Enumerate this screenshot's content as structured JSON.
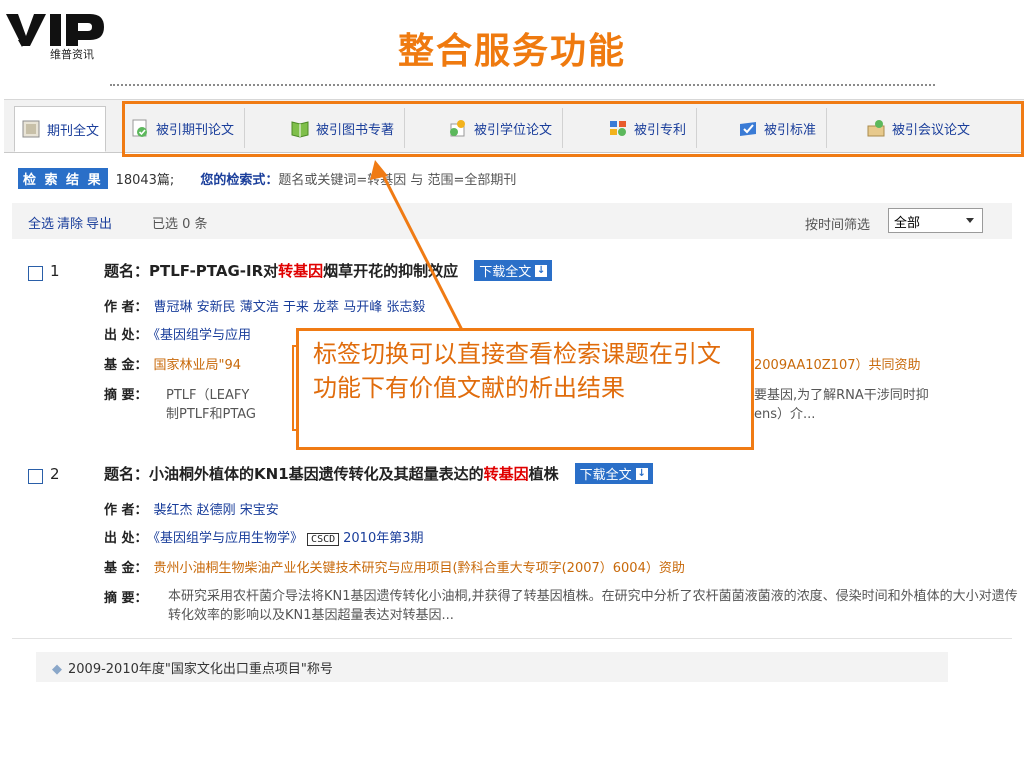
{
  "logo": {
    "brand": "VIP",
    "subtitle": "维普资讯"
  },
  "slide_title": "整合服务功能",
  "tabs": [
    {
      "label": "期刊全文",
      "icon": "journal-icon",
      "active": true
    },
    {
      "label": "被引期刊论文",
      "icon": "cited-paper-icon",
      "active": false
    },
    {
      "label": "被引图书专著",
      "icon": "book-icon",
      "active": false
    },
    {
      "label": "被引学位论文",
      "icon": "degree-thesis-icon",
      "active": false
    },
    {
      "label": "被引专利",
      "icon": "patent-icon",
      "active": false
    },
    {
      "label": "被引标准",
      "icon": "standard-icon",
      "active": false
    },
    {
      "label": "被引会议论文",
      "icon": "conference-icon",
      "active": false
    }
  ],
  "results": {
    "badge": "检 索 结 果",
    "count": "18043篇;",
    "query_label": "您的检索式：",
    "query": "题名或关键词=转基因 与 范围=全部期刊"
  },
  "toolbar": {
    "select_all": "全选",
    "clear": "清除",
    "export": "导出",
    "selected_text": "已选  0  条",
    "filter_label": "按时间筛选",
    "filter_value": "全部"
  },
  "items": [
    {
      "num": "1",
      "title_label": "题名：",
      "title_pre": "PTLF-PTAG-IR对",
      "title_hl": "转基因",
      "title_post": "烟草开花的抑制效应",
      "download": "下载全文",
      "author_label": "作 者：",
      "authors": "曹冠琳 安新民 薄文浩 于来 龙萃 马开峰 张志毅",
      "source_label": "出 处：",
      "source": "《基因组学与应用",
      "fund_label": "基 金：",
      "fund_left": "国家林业局\"94",
      "fund_right": "2009AA10Z107）共同资助",
      "abstract_label": "摘 要：",
      "abstract_l1_left": "PTLF（LEAFY",
      "abstract_l1_right": "要基因,为了解RNA干涉同时抑",
      "abstract_l2_left": "制PTLF和PTAG",
      "abstract_l2_right": "ens）介..."
    },
    {
      "num": "2",
      "title_label": "题名：",
      "title_pre": "小油桐外植体的KN1基因遗传转化及其超量表达的",
      "title_hl": "转基因",
      "title_post": "植株",
      "download": "下载全文",
      "author_label": "作 者：",
      "authors": "裴红杰 赵德刚 宋宝安",
      "source_label": "出 处：",
      "source": "《基因组学与应用生物学》",
      "source_badge": "CSCD",
      "source_issue": "2010年第3期",
      "fund_label": "基 金：",
      "fund": "贵州小油桐生物柴油产业化关键技术研究与应用项目(黔科合重大专项字(2007）6004）资助",
      "abstract_label": "摘 要：",
      "abstract": "本研究采用农杆菌介导法将KN1基因遗传转化小油桐,并获得了转基因植株。在研究中分析了农杆菌菌液菌液的浓度、侵染时间和外植体的大小对遗传转化效率的影响以及KN1基因超量表达对转基因..."
    }
  ],
  "callout": "标签切换可以直接查看检索课题在引文功能下有价值文献的析出结果",
  "footer": "2009-2010年度\"国家文化出口重点项目\"称号",
  "colors": {
    "accent": "#f07b14",
    "link": "#1a3e9b",
    "highlight": "#e00000",
    "badge": "#2a6fc8"
  }
}
